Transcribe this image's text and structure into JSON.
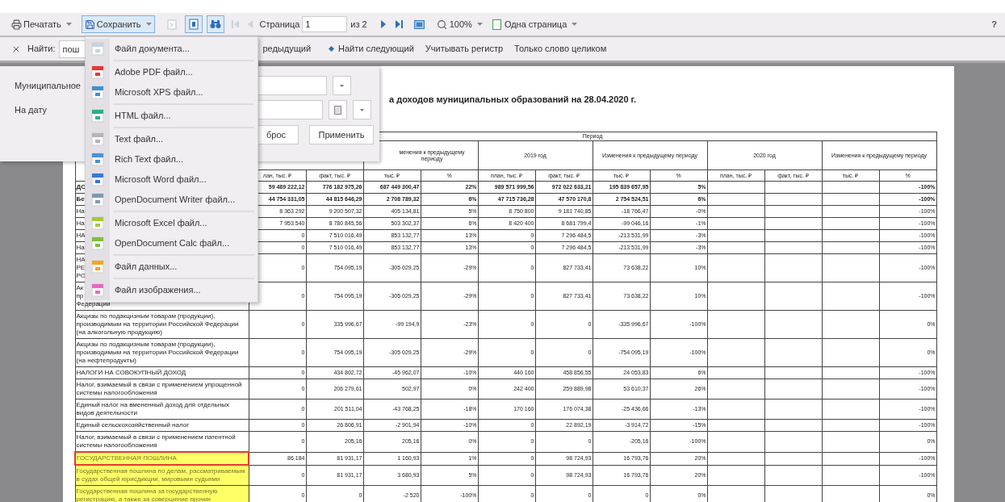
{
  "toolbar": {
    "print": {
      "label": "Печатать"
    },
    "save": {
      "label": "Сохранить",
      "open": true
    },
    "tools": [
      {
        "kind": "export",
        "disabled": true,
        "pressed": false
      },
      {
        "kind": "page",
        "disabled": false,
        "pressed": true
      },
      {
        "kind": "find",
        "disabled": false,
        "pressed": true
      }
    ],
    "nav_back": [
      {
        "kind": "first",
        "disabled": true
      },
      {
        "kind": "prev",
        "disabled": true
      }
    ],
    "page_label": "Страница",
    "page_value": "1",
    "page_total": "из 2",
    "nav_forward": [
      {
        "kind": "next",
        "disabled": false
      },
      {
        "kind": "last",
        "disabled": false
      }
    ],
    "zoom": "100%",
    "view_mode": "Одна страница",
    "help": "?"
  },
  "find_bar": {
    "label": "Найти:",
    "value": "пош",
    "prev": "редыдущий",
    "next": "Найти следующий",
    "match_case": "Учитывать регистр",
    "whole_word": "Только слово целиком"
  },
  "filter_panel": {
    "fields": [
      {
        "label": "Муниципальное",
        "kind": "select"
      },
      {
        "label": "На дату",
        "kind": "date"
      }
    ],
    "buttons": [
      "брос",
      "Применить"
    ]
  },
  "save_menu": {
    "items": [
      {
        "label": "Файл документа...",
        "color": "#c6d2e2",
        "separator_before": false
      },
      {
        "label": "Adobe PDF файл...",
        "color": "#e53935",
        "separator_before": true
      },
      {
        "label": "Microsoft XPS файл...",
        "color": "#3d8fd8",
        "separator_before": false
      },
      {
        "label": "HTML файл...",
        "color": "#2fae8c",
        "separator_before": true
      },
      {
        "label": "Text файл...",
        "color": "#b5b5b5",
        "separator_before": true
      },
      {
        "label": "Rich Text файл...",
        "color": "#4a8fdc",
        "separator_before": false
      },
      {
        "label": "Microsoft Word файл...",
        "color": "#3a78d0",
        "separator_before": false
      },
      {
        "label": "OpenDocument Writer файл...",
        "color": "#7b9bb2",
        "separator_before": false
      },
      {
        "label": "Microsoft Excel файл...",
        "color": "#a5c83a",
        "separator_before": true
      },
      {
        "label": "OpenDocument Calc файл...",
        "color": "#7fbf3f",
        "separator_before": false
      },
      {
        "label": "Файл данных...",
        "color": "#f3a623",
        "separator_before": true
      },
      {
        "label": "Файл изображения...",
        "color": "#e46bc4",
        "separator_before": true
      }
    ]
  },
  "report": {
    "title": "а доходов муниципальных образований на 28.04.2020 г.",
    "period_header": "Период",
    "column_groups": [
      "менения к предыдущему периоду",
      "2019 год",
      "Изменения к предыдущему периоду",
      "2020 год",
      "Изменения к предыдущему периоду"
    ],
    "subheaders": [
      "лан, тыс. ₽",
      "факт, тыс. ₽",
      "тыс. ₽",
      "%",
      "план, тыс. ₽",
      "факт, тыс. ₽",
      "тыс. ₽",
      "%",
      "план, тыс. ₽",
      "факт, тыс. ₽",
      "тыс. ₽",
      "%"
    ],
    "rows": [
      {
        "label": "ДО",
        "bold": true,
        "highlighted": false,
        "selected": false,
        "cells": [
          "59 489 222,12",
          "776 182 975,26",
          "687 449 300,47",
          "22%",
          "989 571 999,56",
          "972 022 633,21",
          "195 839 657,95",
          "5%"
        ],
        "change_2020_pct": "-100%"
      },
      {
        "label": "Бе",
        "bold": true,
        "highlighted": false,
        "selected": false,
        "cells": [
          "44 754 331,05",
          "44 815 646,29",
          "2 708 789,32",
          "6%",
          "47 715 736,28",
          "47 570 170,8",
          "2 754 524,51",
          "6%"
        ],
        "change_2020_pct": "-100%"
      },
      {
        "label": "На",
        "bold": false,
        "highlighted": false,
        "selected": false,
        "cells": [
          "8 363 292",
          "9 200 507,32",
          "405 134,81",
          "5%",
          "8 750 800",
          "9 181 740,85",
          "-18 766,47",
          "-0%"
        ],
        "change_2020_pct": "-100%"
      },
      {
        "label": "На",
        "bold": false,
        "highlighted": false,
        "selected": false,
        "cells": [
          "7 953 540",
          "8 780 845,56",
          "503 302,37",
          "6%",
          "8 420 400",
          "8 681 799,4",
          "-99 046,16",
          "-1%"
        ],
        "change_2020_pct": "-100%"
      },
      {
        "label": "НА",
        "bold": false,
        "highlighted": false,
        "selected": false,
        "cells": [
          "0",
          "7 510 016,49",
          "853 132,77",
          "13%",
          "0",
          "7 296 484,5",
          "-213 531,99",
          "-3%"
        ],
        "change_2020_pct": "-100%"
      },
      {
        "label": "На",
        "bold": false,
        "highlighted": false,
        "selected": false,
        "cells": [
          "0",
          "7 510 016,49",
          "853 132,77",
          "13%",
          "0",
          "7 296 484,5",
          "-213 531,99",
          "-3%"
        ],
        "change_2020_pct": "-100%"
      },
      {
        "label": "НА\nРЕ\nРО",
        "bold": false,
        "highlighted": false,
        "selected": false,
        "cells": [
          "0",
          "754 095,19",
          "-305 029,25",
          "-29%",
          "0",
          "827 733,41",
          "73 638,22",
          "10%"
        ],
        "change_2020_pct": "-100%"
      },
      {
        "label": "Ак\nпр\nФедерации",
        "bold": false,
        "highlighted": false,
        "selected": false,
        "cells": [
          "0",
          "754 095,19",
          "-305 029,25",
          "-29%",
          "0",
          "827 733,41",
          "73 638,22",
          "10%"
        ],
        "change_2020_pct": "-100%"
      },
      {
        "label": "Акцизы по подакцизным товарам (продукции), производимым на территории Российской Федерации (на алкогольную продукцию)",
        "bold": false,
        "highlighted": false,
        "selected": false,
        "cells": [
          "0",
          "335 996,67",
          "-99 194,9",
          "-23%",
          "0",
          "0",
          "-335 996,67",
          "-100%"
        ],
        "change_2020_pct": "0%"
      },
      {
        "label": "Акцизы по подакцизным товарам (продукции), производимым на территории Российской Федерации (на нефтепродукты)",
        "bold": false,
        "highlighted": false,
        "selected": false,
        "cells": [
          "0",
          "754 095,19",
          "-305 029,25",
          "-29%",
          "0",
          "0",
          "-754 095,19",
          "-100%"
        ],
        "change_2020_pct": "0%"
      },
      {
        "label": "НАЛОГИ НА СОВОКУПНЫЙ ДОХОД",
        "bold": false,
        "highlighted": false,
        "selected": false,
        "cells": [
          "0",
          "434 802,72",
          "-45 962,07",
          "-10%",
          "440 160",
          "458 856,55",
          "24 053,83",
          "6%"
        ],
        "change_2020_pct": "-100%"
      },
      {
        "label": "Налог, взимаемый в связи с применением упрощенной системы налогообложения",
        "bold": false,
        "highlighted": false,
        "selected": false,
        "cells": [
          "0",
          "206 279,61",
          "502,97",
          "0%",
          "242 400",
          "259 889,98",
          "53 610,37",
          "26%"
        ],
        "change_2020_pct": "-100%"
      },
      {
        "label": "Единый налог на вмененный доход для отдельных видов деятельности",
        "bold": false,
        "highlighted": false,
        "selected": false,
        "cells": [
          "0",
          "201 511,04",
          "-43 768,25",
          "-18%",
          "170 160",
          "176 074,38",
          "-25 436,66",
          "-13%"
        ],
        "change_2020_pct": "-100%"
      },
      {
        "label": "Единый сельскохозяйственный налог",
        "bold": false,
        "highlighted": false,
        "selected": false,
        "cells": [
          "0",
          "26 806,91",
          "-2 901,94",
          "-10%",
          "0",
          "22 892,19",
          "-3 914,72",
          "-15%"
        ],
        "change_2020_pct": "-100%"
      },
      {
        "label": "Налог, взимаемый в связи с применением патентной системы налогообложения",
        "bold": false,
        "highlighted": false,
        "selected": false,
        "cells": [
          "0",
          "205,16",
          "205,16",
          "0%",
          "0",
          "0",
          "-205,16",
          "-100%"
        ],
        "change_2020_pct": "0%"
      },
      {
        "label": "ГОСУДАРСТВЕННАЯ ПОШЛИНА",
        "bold": false,
        "highlighted": true,
        "selected": true,
        "cells": [
          "86 184",
          "81 931,17",
          "1 160,93",
          "1%",
          "0",
          "98 724,93",
          "16 793,76",
          "20%"
        ],
        "change_2020_pct": "-100%"
      },
      {
        "label": "Государственная пошлина по делам, рассматриваемым в судах общей юрисдикции, мировыми судьями",
        "bold": false,
        "highlighted": true,
        "selected": false,
        "cells": [
          "0",
          "81 931,17",
          "3 680,93",
          "5%",
          "0",
          "98 724,93",
          "16 793,76",
          "20%"
        ],
        "change_2020_pct": "-100%"
      },
      {
        "label": "Государственная пошлина за государственную регистрацию, а также за совершение прочих",
        "bold": false,
        "highlighted": true,
        "selected": false,
        "cells": [
          "0",
          "0",
          "-2 520",
          "-100%",
          "0",
          "0",
          "0",
          "0%"
        ],
        "change_2020_pct": "0%"
      }
    ]
  }
}
